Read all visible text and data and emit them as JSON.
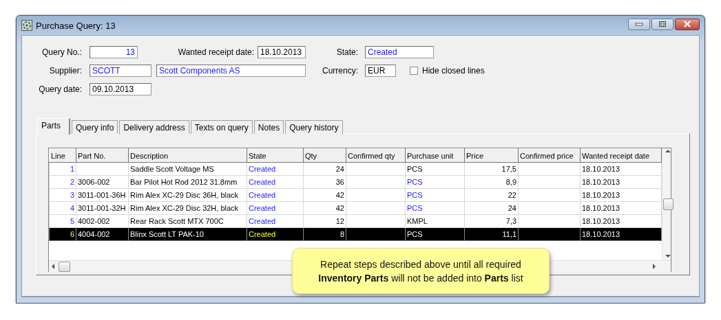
{
  "window": {
    "title": "Purchase Query: 13"
  },
  "header": {
    "query_no": {
      "label": "Query No.:",
      "value": "13",
      "linked": true
    },
    "wanted_receipt_date": {
      "label": "Wanted receipt date:",
      "value": "18.10.2013",
      "linked": false
    },
    "state": {
      "label": "State:",
      "value": "Created",
      "linked": true
    },
    "supplier": {
      "label": "Supplier:",
      "value": "SCOTT",
      "name": "Scott Components AS",
      "linked": true
    },
    "currency": {
      "label": "Currency:",
      "value": "EUR",
      "linked": false
    },
    "hide_closed_lines": {
      "label": "Hide closed lines",
      "checked": false
    },
    "query_date": {
      "label": "Query date:",
      "value": "09.10.2013",
      "linked": false
    }
  },
  "tabs": [
    {
      "label": "Parts",
      "selected": true
    },
    {
      "label": "Query info",
      "selected": false
    },
    {
      "label": "Delivery address",
      "selected": false
    },
    {
      "label": "Texts on query",
      "selected": false
    },
    {
      "label": "Notes",
      "selected": false
    },
    {
      "label": "Query history",
      "selected": false
    }
  ],
  "table": {
    "columns": [
      "Line",
      "Part No.",
      "Description",
      "State",
      "Qty",
      "Confirmed qty",
      "Purchase unit",
      "Price",
      "Confirmed price",
      "Wanted receipt date"
    ],
    "rows": [
      {
        "line": "1",
        "description": "Saddle Scott Voltage MS",
        "state": "Created",
        "qty": "24",
        "purchase_unit": "PCS",
        "unit_linked": false,
        "price": "17,5",
        "wanted_receipt_date": "18.10.2013",
        "selected": false
      },
      {
        "line": "2",
        "part_no": "3006-002",
        "description": "Bar Pilot Hot Rod 2012 31.8mm",
        "state": "Created",
        "qty": "36",
        "purchase_unit": "PCS",
        "unit_linked": true,
        "price": "8,9",
        "wanted_receipt_date": "18.10.2013",
        "selected": false
      },
      {
        "line": "3",
        "part_no": "3011-001-36H",
        "description": "Rim Alex XC-29 Disc 36H, black",
        "state": "Created",
        "qty": "42",
        "purchase_unit": "PCS",
        "unit_linked": true,
        "price": "22",
        "wanted_receipt_date": "18.10.2013",
        "selected": false
      },
      {
        "line": "4",
        "part_no": "3011-001-32H",
        "description": "Rim Alex XC-29 Disc 32H, black",
        "state": "Created",
        "qty": "42",
        "purchase_unit": "PCS",
        "unit_linked": true,
        "price": "24",
        "wanted_receipt_date": "18.10.2013",
        "selected": false
      },
      {
        "line": "5",
        "part_no": "4002-002",
        "description": "Rear Rack Scott MTX 700C",
        "state": "Created",
        "qty": "12",
        "purchase_unit": "KMPL",
        "unit_linked": false,
        "price": "7,3",
        "wanted_receipt_date": "18.10.2013",
        "selected": false
      },
      {
        "line": "6",
        "part_no": "4004-002",
        "description": "Blinx Scott LT PAK-10",
        "state": "Created",
        "qty": "8",
        "purchase_unit": "PCS",
        "unit_linked": false,
        "price": "11,1",
        "wanted_receipt_date": "18.10.2013",
        "selected": true
      }
    ]
  },
  "callout": {
    "text": "Repeat steps described above until all required **Inventory Parts** will not be added into **Parts** list"
  }
}
